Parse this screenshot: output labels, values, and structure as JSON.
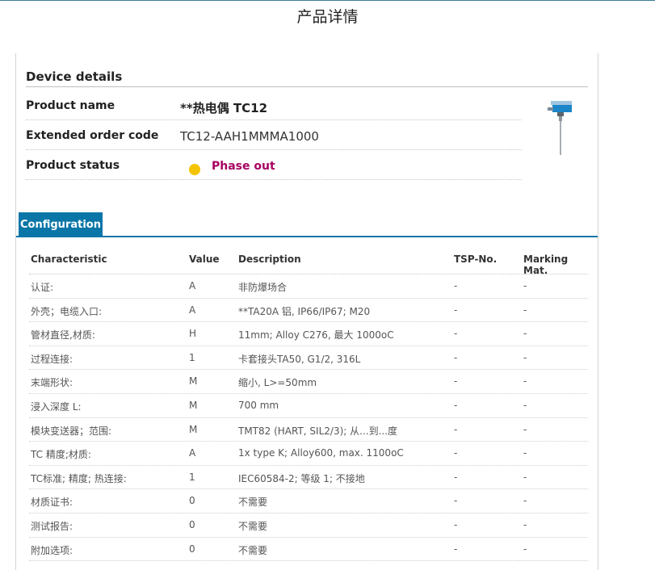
{
  "page": {
    "title": "产品详情"
  },
  "device": {
    "section_title": "Device details",
    "rows": [
      {
        "label": "Product name",
        "value": "**热电偶 TC12"
      },
      {
        "label": "Extended order code",
        "value": "TC12-AAH1MMMA1000"
      },
      {
        "label": "Product status",
        "value": "Phase out"
      }
    ],
    "status_color": "#f5c400",
    "status_text_color": "#a6005f",
    "image_icon": "thermocouple-product-image"
  },
  "config": {
    "tab_label": "Configuration",
    "accent": "#0a76a8",
    "columns": [
      "Characteristic",
      "Value",
      "Description",
      "TSP-No.",
      "Marking Mat."
    ],
    "rows": [
      {
        "characteristic": "认证:",
        "value": "A",
        "description": "非防爆场合",
        "tsp": "-",
        "marking": "-"
      },
      {
        "characteristic": "外壳；电缆入口:",
        "value": "A",
        "description": "**TA20A 铝, IP66/IP67; M20",
        "tsp": "-",
        "marking": "-"
      },
      {
        "characteristic": "管材直径,材质:",
        "value": "H",
        "description": "11mm; Alloy C276, 最大 1000oC",
        "tsp": "-",
        "marking": "-"
      },
      {
        "characteristic": "过程连接:",
        "value": "1",
        "description": "卡套接头TA50, G1/2, 316L",
        "tsp": "-",
        "marking": "-"
      },
      {
        "characteristic": "末端形状:",
        "value": "M",
        "description": "缩小, L>=50mm",
        "tsp": "-",
        "marking": "-"
      },
      {
        "characteristic": "浸入深度 L:",
        "value": "M",
        "description": "700 mm",
        "tsp": "-",
        "marking": "-"
      },
      {
        "characteristic": "模块变送器；范围:",
        "value": "M",
        "description": "TMT82 (HART, SIL2/3); 从...到...度",
        "tsp": "-",
        "marking": "-"
      },
      {
        "characteristic": "TC 精度;材质:",
        "value": "A",
        "description": "1x type K; Alloy600, max. 1100oC",
        "tsp": "-",
        "marking": "-"
      },
      {
        "characteristic": "TC标准; 精度; 热连接:",
        "value": "1",
        "description": "IEC60584-2; 等级 1; 不接地",
        "tsp": "-",
        "marking": "-"
      },
      {
        "characteristic": "材质证书:",
        "value": "0",
        "description": "不需要",
        "tsp": "-",
        "marking": "-"
      },
      {
        "characteristic": "测试报告:",
        "value": "0",
        "description": "不需要",
        "tsp": "-",
        "marking": "-"
      },
      {
        "characteristic": "附加选项:",
        "value": "0",
        "description": "不需要",
        "tsp": "-",
        "marking": "-"
      }
    ]
  }
}
